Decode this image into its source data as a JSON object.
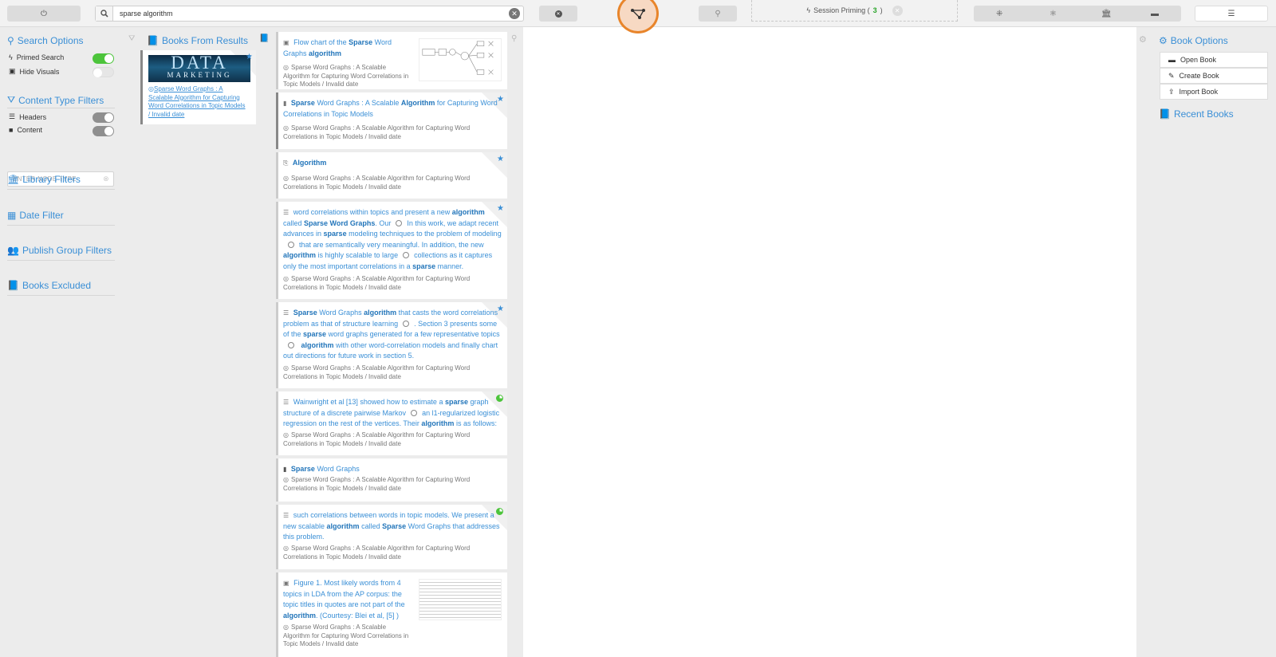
{
  "search": {
    "query": "sparse algorithm"
  },
  "priming": {
    "label": "Session Priming (",
    "count": "3",
    "suffix": ")"
  },
  "left": {
    "search_options": "Search Options",
    "primed_search": "Primed Search",
    "hide_visuals": "Hide Visuals",
    "content_type_filters": "Content Type Filters",
    "headers": "Headers",
    "content": "Content",
    "node_type_placeholder": "ENTER NODE TYPE",
    "library_filters": "Library Filters",
    "date_filter": "Date Filter",
    "publish_group_filters": "Publish Group Filters",
    "books_excluded": "Books Excluded"
  },
  "books": {
    "title": "Books From Results",
    "cover_top": "DATA",
    "cover_bottom": "MARKETING",
    "link": "Sparse Word Graphs : A Scalable Algorithm for Capturing Word Correlations in Topic Models / Invalid date"
  },
  "results": {
    "meta_short": "Sparse Word Graphs : A Scalable Algorithm for Capturing Word Correlations in Topic Models / Invalid date",
    "r1": {
      "a": "Flow chart of the ",
      "b": "Sparse",
      "c": " Word Graphs ",
      "d": "algorithm"
    },
    "r2": {
      "a": "Sparse",
      "b": " Word Graphs : A Scalable ",
      "c": "Algorithm",
      "d": " for Capturing Word Correlations in Topic Models"
    },
    "r3": {
      "a": "Algorithm"
    },
    "r4": {
      "a": "word correlations within topics and present a new ",
      "b": "algorithm",
      "c": " called ",
      "d": "Sparse Word Graphs",
      "e": ". Our",
      "f": "In this work, we adapt recent advances in ",
      "g": "sparse",
      "h": " modeling techniques to the problem of modeling",
      "i": "that are semantically very meaningful. In addition, the new ",
      "j": "algorithm",
      "k": " is highly scalable to large",
      "l": "collections as it captures only the most important correlations in a ",
      "m": "sparse",
      "n": " manner."
    },
    "r5": {
      "a": "Sparse",
      "b": " Word Graphs ",
      "c": "algorithm",
      "d": " that casts the word correlations problem as that of structure learning",
      "e": ". Section 3 presents some of the ",
      "f": "sparse",
      "g": " word graphs generated for a few representative topics",
      "h": "algorithm",
      "i": " with other word-correlation models and finally chart out directions for future work in section 5."
    },
    "r6": {
      "a": "Wainwright et al [13] showed how to estimate a ",
      "b": "sparse",
      "c": " graph structure of a discrete pairwise Markov",
      "d": "an l1-regularized logistic regression on the rest of the vertices. Their ",
      "e": "algorithm",
      "f": " is as follows:"
    },
    "r7": {
      "a": "Sparse",
      "b": " Word Graphs"
    },
    "r8": {
      "a": "such correlations between words in topic models. We present a new scalable ",
      "b": "algorithm",
      "c": " called ",
      "d": "Sparse",
      "e": " Word Graphs that addresses this problem."
    },
    "r9": {
      "a": "Figure 1. Most likely words from 4 topics in LDA from the AP corpus: the topic titles in quotes are not part of the ",
      "b": "algorithm",
      "c": ". (Courtesy: Blei et al, [5] )"
    }
  },
  "book_options": {
    "title": "Book Options",
    "open": "Open Book",
    "create": "Create Book",
    "import": "Import Book",
    "recent": "Recent Books"
  }
}
